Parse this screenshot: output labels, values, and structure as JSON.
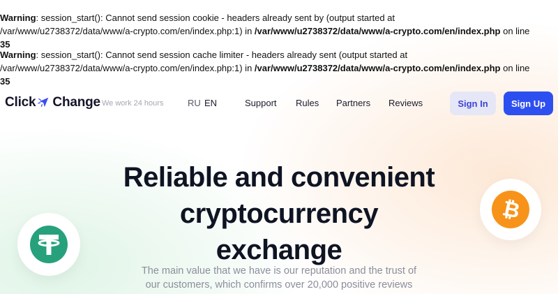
{
  "warnings": [
    {
      "label": "Warning",
      "message": ": session_start(): Cannot send session cookie - headers already sent by (output started at /var/www/u2738372/data/www/a-crypto.com/en/index.php:1) in ",
      "file": "/var/www/u2738372/data/www/a-crypto.com/en/index.php",
      "on_line": " on line ",
      "line": "35"
    },
    {
      "label": "Warning",
      "message": ": session_start(): Cannot send session cache limiter - headers already sent (output started at /var/www/u2738372/data/www/a-crypto.com/en/index.php:1) in ",
      "file": "/var/www/u2738372/data/www/a-crypto.com/en/index.php",
      "on_line": " on line ",
      "line": "35"
    }
  ],
  "header": {
    "logo_left": "Click",
    "logo_right": "Change",
    "tagline": "We work 24 hours",
    "languages": [
      "RU",
      "EN"
    ],
    "nav": [
      "Support",
      "Rules",
      "Partners",
      "Reviews"
    ],
    "sign_in": "Sign In",
    "sign_up": "Sign Up"
  },
  "hero": {
    "title_lines": [
      "Reliable and convenient",
      "cryptocurrency",
      "exchange"
    ],
    "subtitle_lines": [
      "The main value that we have is our reputation and the trust of",
      "our customers, which confirms over 20,000 positive reviews"
    ]
  },
  "icons": {
    "logo_arrow": "cursor-arrow-icon",
    "tether": "tether-coin-icon",
    "bitcoin": "bitcoin-coin-icon"
  },
  "colors": {
    "primary_button": "#2e4ff0",
    "secondary_button": "#e6e7f6",
    "secondary_button_text": "#3d44d6",
    "tether_green": "#26a17b",
    "bitcoin_orange": "#f7931a"
  }
}
